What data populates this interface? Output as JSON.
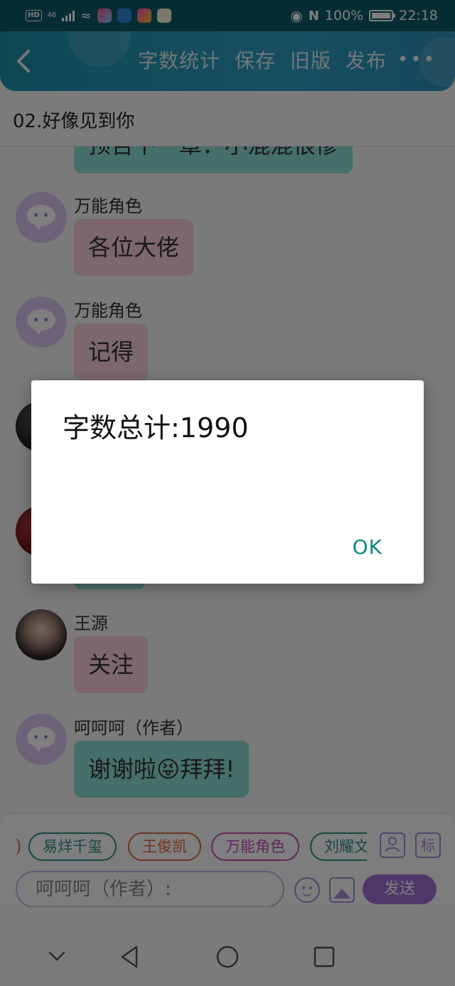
{
  "status_bar": {
    "badge": "HD",
    "network": "46",
    "battery_percent": "100%",
    "time": "22:18",
    "icons": [
      "signal-icon",
      "wifi-icon",
      "app-icon",
      "eye-icon",
      "nfc-icon",
      "battery-icon"
    ]
  },
  "header": {
    "back_icon": "chevron-left-icon",
    "actions": [
      "字数统计",
      "保存",
      "旧版",
      "发布"
    ],
    "more_icon": "more-dots-icon",
    "color": "#2b9bbd"
  },
  "chapter": {
    "title": "02.好像见到你"
  },
  "chat": {
    "partial_message": "预告下一章：小混混很惨",
    "messages": [
      {
        "name": "万能角色",
        "text": "各位大佬",
        "avatar": "chat-bubble-avatar"
      },
      {
        "name": "万能角色",
        "text": "记得",
        "avatar": "chat-bubble-avatar"
      },
      {
        "name": "王源",
        "text": "关注",
        "avatar": "photo-avatar"
      },
      {
        "name": "呵呵呵（作者）",
        "text": "谢谢啦😝拜拜!",
        "avatar": "chat-bubble-avatar"
      }
    ]
  },
  "input_panel": {
    "roles": [
      {
        "label": "易烊千玺",
        "color": "#2f8f86"
      },
      {
        "label": "王俊凯",
        "color": "#d9673c"
      },
      {
        "label": "万能角色",
        "color": "#c24fb5"
      },
      {
        "label": "刘耀文",
        "color": "#2f8f86"
      }
    ],
    "person_icon": "person-icon",
    "tag_label": "标",
    "role_input_placeholder": "呵呵呵（作者）:",
    "emoji_icon": "emoji-icon",
    "image_icon": "image-icon",
    "send_label": "发送",
    "send_color": "#9c71d4"
  },
  "nav_bar": {
    "buttons": [
      "chevron-down-icon",
      "back-triangle-icon",
      "home-circle-icon",
      "recents-square-icon"
    ]
  },
  "dialog": {
    "message": "字数总计:1990",
    "ok_label": "OK",
    "ok_color": "#0c8a80"
  }
}
